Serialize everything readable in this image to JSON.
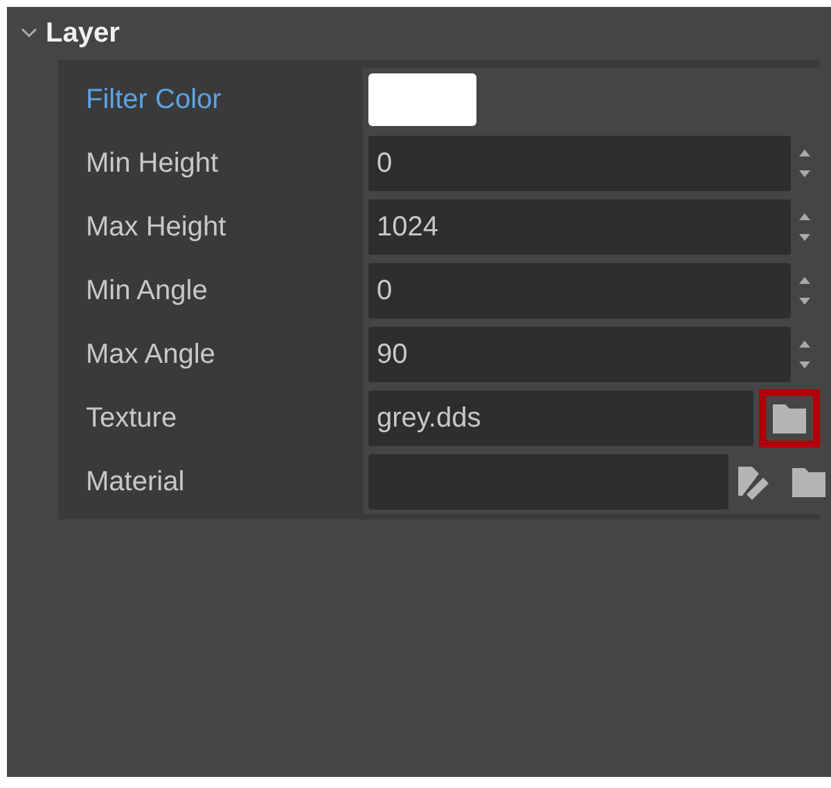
{
  "section": {
    "title": "Layer",
    "expanded": true
  },
  "rows": [
    {
      "label": "Filter Color",
      "selected": true,
      "kind": "color",
      "color": "#ffffff"
    },
    {
      "label": "Min Height",
      "selected": false,
      "kind": "spin",
      "value": "0"
    },
    {
      "label": "Max Height",
      "selected": false,
      "kind": "spin",
      "value": "1024"
    },
    {
      "label": "Min Angle",
      "selected": false,
      "kind": "spin",
      "value": "0"
    },
    {
      "label": "Max Angle",
      "selected": false,
      "kind": "spin",
      "value": "90"
    },
    {
      "label": "Texture",
      "selected": false,
      "kind": "file",
      "value": "grey.dds",
      "highlighted": true
    },
    {
      "label": "Material",
      "selected": false,
      "kind": "material",
      "highlighted": false
    }
  ]
}
